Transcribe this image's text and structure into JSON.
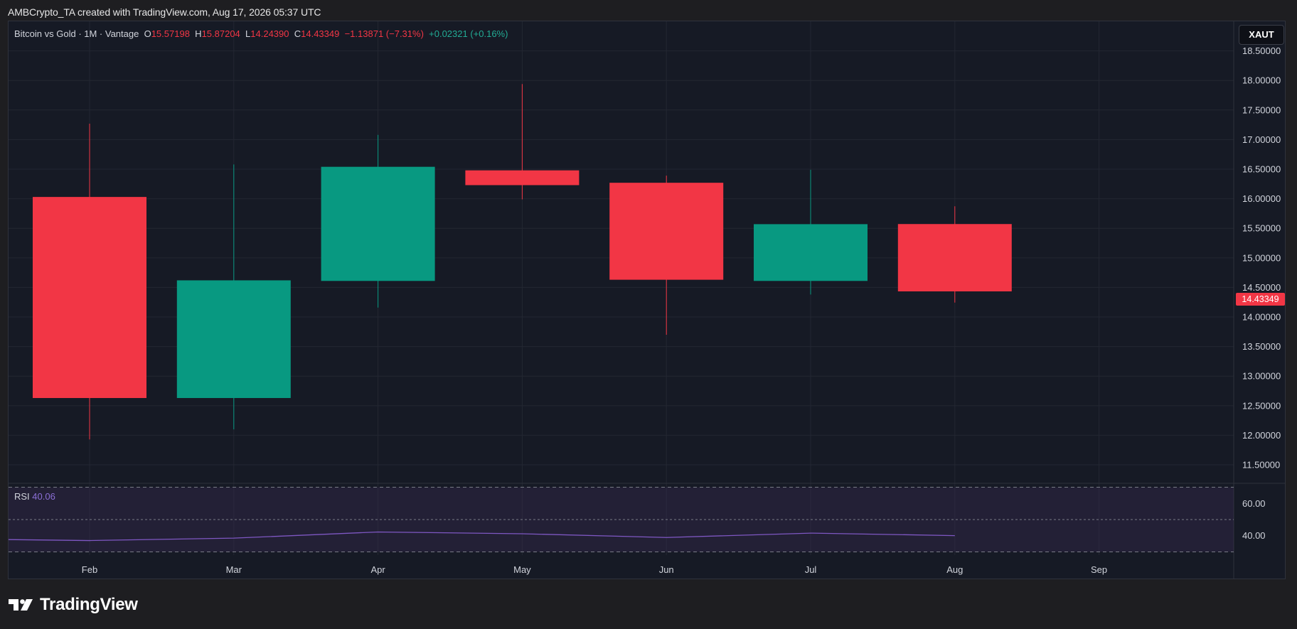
{
  "header": {
    "attribution": "AMBCrypto_TA created with TradingView.com, Aug 17, 2026 05:37 UTC"
  },
  "legend": {
    "title": "Bitcoin vs Gold · 1M · Vantage",
    "open_label": "O",
    "open_value": "15.57198",
    "high_label": "H",
    "high_value": "15.87204",
    "low_label": "L",
    "low_value": "14.24390",
    "close_label": "C",
    "close_value": "14.43349",
    "change": "−1.13871 (−7.31%)",
    "secondary_change": "+0.02321 (+0.16%)"
  },
  "symbol_button": {
    "label": "XAUT"
  },
  "last_price_label": "14.43349",
  "rsi": {
    "label": "RSI",
    "value": "40.06"
  },
  "brand": {
    "name": "TradingView",
    "logo_icon": "tradingview-logo-icon"
  },
  "colors": {
    "bullish": "#089981",
    "bearish": "#f23645",
    "background": "#161a25",
    "grid": "#232732",
    "axis_text": "#d1d4dc",
    "rsi_line": "#7e57c2",
    "rsi_band": "#3b2f57"
  },
  "chart_data": [
    {
      "type": "candlestick",
      "title": "Bitcoin vs Gold · 1M · Vantage",
      "categories": [
        "Feb",
        "Mar",
        "Apr",
        "May",
        "Jun",
        "Jul",
        "Aug"
      ],
      "x_axis_ticks": [
        "Feb",
        "Mar",
        "Apr",
        "May",
        "Jun",
        "Jul",
        "Aug",
        "Sep"
      ],
      "candles": [
        {
          "label": "Feb",
          "open": 16.03,
          "high": 17.27,
          "low": 11.93,
          "close": 12.63
        },
        {
          "label": "Mar",
          "open": 12.63,
          "high": 16.58,
          "low": 12.1,
          "close": 14.62
        },
        {
          "label": "Apr",
          "open": 14.61,
          "high": 17.08,
          "low": 14.16,
          "close": 16.54
        },
        {
          "label": "May",
          "open": 16.48,
          "high": 17.94,
          "low": 15.99,
          "close": 16.23
        },
        {
          "label": "Jun",
          "open": 16.27,
          "high": 16.39,
          "low": 13.7,
          "close": 14.63
        },
        {
          "label": "Jul",
          "open": 14.61,
          "high": 16.49,
          "low": 14.38,
          "close": 15.57
        },
        {
          "label": "Aug",
          "open": 15.57198,
          "high": 15.87204,
          "low": 14.2439,
          "close": 14.43349
        }
      ],
      "y_ticks": [
        "11.50000",
        "12.00000",
        "12.50000",
        "13.00000",
        "13.50000",
        "14.00000",
        "14.50000",
        "15.00000",
        "15.50000",
        "16.00000",
        "16.50000",
        "17.00000",
        "17.50000",
        "18.00000",
        "18.50000"
      ],
      "ylim": [
        11.2,
        19.0
      ],
      "grid": true,
      "last_value": 14.43349
    },
    {
      "type": "line",
      "title": "RSI",
      "categories": [
        "Feb",
        "Mar",
        "Apr",
        "May",
        "Jun",
        "Jul",
        "Aug"
      ],
      "series": [
        {
          "name": "RSI",
          "values": [
            37.0,
            38.5,
            42.3,
            41.2,
            38.9,
            41.6,
            40.06
          ]
        }
      ],
      "bands": [
        30,
        50,
        70
      ],
      "y_ticks": [
        "40.00",
        "60.00"
      ],
      "ylim": [
        28,
        72
      ]
    }
  ]
}
